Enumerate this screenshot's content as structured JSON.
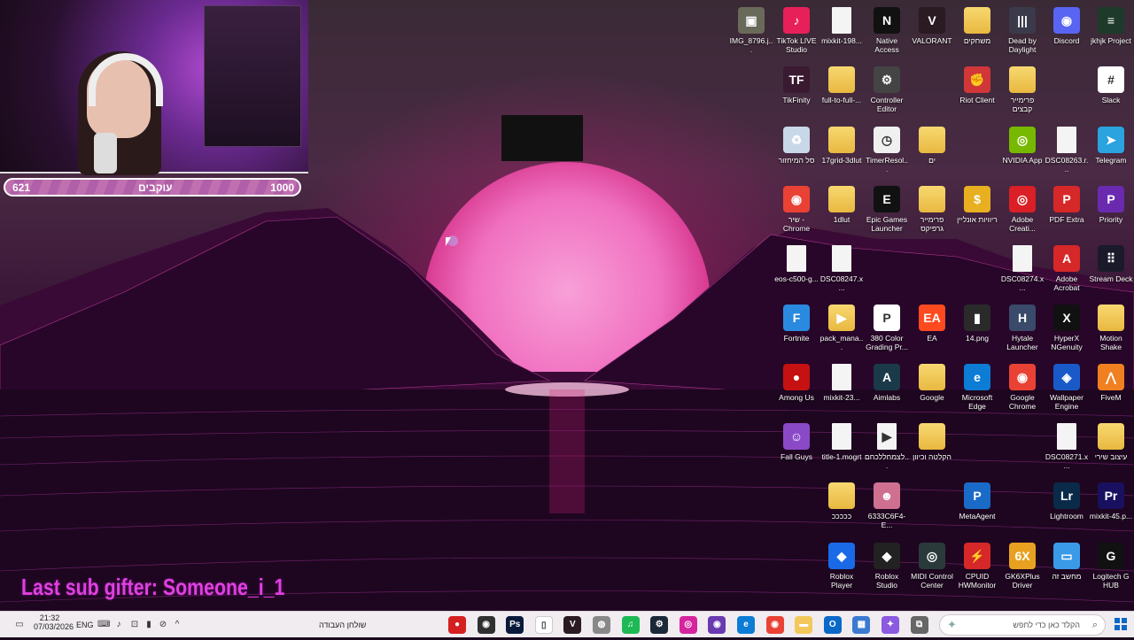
{
  "webcam": {
    "followers_current": "621",
    "followers_label": "עוקבים",
    "followers_goal": "1000",
    "progress": 0.62
  },
  "overlay": {
    "last_sub_gifter": "Last sub gifter: Someone_i_1"
  },
  "desktop_icons": [
    {
      "label": "IMG_8796.j...",
      "icon": "image-icon",
      "color": "#6a6a5a",
      "glyph": "▣"
    },
    {
      "label": "TikTok LIVE Studio",
      "icon": "tiktok-icon",
      "color": "#e8205a",
      "glyph": "♪"
    },
    {
      "label": "mixkit-198...",
      "icon": "file-icon",
      "color": "#f4f4f4",
      "glyph": ""
    },
    {
      "label": "Native Access",
      "icon": "native-access-icon",
      "color": "#111111",
      "glyph": "N"
    },
    {
      "label": "VALORANT",
      "icon": "valorant-icon",
      "color": "#2a1a22",
      "glyph": "V"
    },
    {
      "label": "משחקים",
      "icon": "folder-icon",
      "color": "#f2c85a",
      "glyph": ""
    },
    {
      "label": "Dead by Daylight",
      "icon": "dbd-icon",
      "color": "#3a3a4a",
      "glyph": "|||"
    },
    {
      "label": "Discord",
      "icon": "discord-icon",
      "color": "#5865f2",
      "glyph": "◉"
    },
    {
      "label": "jkhjk Project",
      "icon": "project-icon",
      "color": "#1e3a2a",
      "glyph": "≡"
    },
    {
      "label": "TikFinity",
      "icon": "tikfinity-icon",
      "color": "#3a1a30",
      "glyph": "TF"
    },
    {
      "label": "full-to-full-...",
      "icon": "folder-icon",
      "color": "#f2c85a",
      "glyph": ""
    },
    {
      "label": "Controller Editor",
      "icon": "controller-icon",
      "color": "#444444",
      "glyph": "⚙"
    },
    {
      "label": "Riot Client",
      "icon": "riot-icon",
      "color": "#d13639",
      "glyph": "✊"
    },
    {
      "label": "פרימייר קבצים",
      "icon": "folder-icon",
      "color": "#f2c85a",
      "glyph": ""
    },
    {
      "label": "Slack",
      "icon": "slack-icon",
      "color": "#ffffff",
      "glyph": "#"
    },
    {
      "label": "סל המיחזור",
      "icon": "recycle-bin-icon",
      "color": "#c8d8e8",
      "glyph": "♻"
    },
    {
      "label": "17grid-3dlut",
      "icon": "folder-icon",
      "color": "#f2c85a",
      "glyph": ""
    },
    {
      "label": "TimerResol...",
      "icon": "timer-icon",
      "color": "#f0f0f0",
      "glyph": "◷"
    },
    {
      "label": "ים",
      "icon": "folder-icon",
      "color": "#f2c85a",
      "glyph": ""
    },
    {
      "label": "NVIDIA App",
      "icon": "nvidia-icon",
      "color": "#76b900",
      "glyph": "◎"
    },
    {
      "label": "DSC08263.r...",
      "icon": "file-icon",
      "color": "#f4f4f4",
      "glyph": ""
    },
    {
      "label": "Telegram",
      "icon": "telegram-icon",
      "color": "#2aa3df",
      "glyph": "➤"
    },
    {
      "label": "שיר - Chrome",
      "icon": "chrome-icon",
      "color": "#e94235",
      "glyph": "◉"
    },
    {
      "label": "1dlut",
      "icon": "folder-icon",
      "color": "#f2c85a",
      "glyph": ""
    },
    {
      "label": "Epic Games Launcher",
      "icon": "epic-icon",
      "color": "#111111",
      "glyph": "E"
    },
    {
      "label": "פרימייר גרפיקס",
      "icon": "folder-icon",
      "color": "#f2c85a",
      "glyph": ""
    },
    {
      "label": "ריוויות אונליין",
      "icon": "coin-icon",
      "color": "#e8b020",
      "glyph": "$"
    },
    {
      "label": "Adobe Creati...",
      "icon": "adobe-cc-icon",
      "color": "#da1f26",
      "glyph": "◎"
    },
    {
      "label": "PDF Extra",
      "icon": "pdf-extra-icon",
      "color": "#d62828",
      "glyph": "P"
    },
    {
      "label": "Priority",
      "icon": "priority-icon",
      "color": "#6a2ab0",
      "glyph": "P"
    },
    {
      "label": "eos-c500-g...",
      "icon": "pdf-file-icon",
      "color": "#f4f4f4",
      "glyph": ""
    },
    {
      "label": "DSC08247.x...",
      "icon": "file-icon",
      "color": "#f4f4f4",
      "glyph": ""
    },
    {
      "label": "DSC08274.x...",
      "icon": "file-icon",
      "color": "#f4f4f4",
      "glyph": ""
    },
    {
      "label": "Adobe Acrobat",
      "icon": "acrobat-icon",
      "color": "#d62828",
      "glyph": "A"
    },
    {
      "label": "Stream Deck",
      "icon": "stream-deck-icon",
      "color": "#1a1a2a",
      "glyph": "⠿"
    },
    {
      "label": "Fortnite",
      "icon": "fortnite-icon",
      "color": "#2a8ae0",
      "glyph": "F"
    },
    {
      "label": "pack_mana...",
      "icon": "zip-folder-icon",
      "color": "#f2c85a",
      "glyph": "▶"
    },
    {
      "label": "380 Color Grading Pr...",
      "icon": "pset-icon",
      "color": "#ffffff",
      "glyph": "P"
    },
    {
      "label": "EA",
      "icon": "ea-icon",
      "color": "#ff4a20",
      "glyph": "EA"
    },
    {
      "label": "14.png",
      "icon": "png-file-icon",
      "color": "#2a2a2a",
      "glyph": "▮"
    },
    {
      "label": "Hytale Launcher",
      "icon": "hytale-icon",
      "color": "#3a4a6a",
      "glyph": "H"
    },
    {
      "label": "HyperX NGenuity",
      "icon": "hyperx-icon",
      "color": "#111111",
      "glyph": "X"
    },
    {
      "label": "Motion Shake",
      "icon": "folder-icon",
      "color": "#f2c85a",
      "glyph": ""
    },
    {
      "label": "Among Us",
      "icon": "among-us-icon",
      "color": "#c51111",
      "glyph": "●"
    },
    {
      "label": "mixkit-23...",
      "icon": "file-icon",
      "color": "#f4f4f4",
      "glyph": ""
    },
    {
      "label": "Aimlabs",
      "icon": "aimlabs-icon",
      "color": "#1a3a4a",
      "glyph": "A"
    },
    {
      "label": "Google",
      "icon": "folder-icon",
      "color": "#f2c85a",
      "glyph": ""
    },
    {
      "label": "Microsoft Edge",
      "icon": "edge-icon",
      "color": "#0c7cd5",
      "glyph": "e"
    },
    {
      "label": "Google Chrome",
      "icon": "chrome-icon",
      "color": "#e94235",
      "glyph": "◉"
    },
    {
      "label": "Wallpaper Engine",
      "icon": "wallpaper-engine-icon",
      "color": "#1a5ac8",
      "glyph": "◈"
    },
    {
      "label": "FiveM",
      "icon": "fivem-icon",
      "color": "#f08020",
      "glyph": "⋀"
    },
    {
      "label": "Fall Guys",
      "icon": "fall-guys-icon",
      "color": "#8a4ac8",
      "glyph": "☺"
    },
    {
      "label": "title-1.mogrt",
      "icon": "file-icon",
      "color": "#f4f4f4",
      "glyph": ""
    },
    {
      "label": "לצמחללכחם...",
      "icon": "video-file-icon",
      "color": "#f4f4f4",
      "glyph": "▶"
    },
    {
      "label": "הקלטה וכיוון",
      "icon": "folder-icon",
      "color": "#f2c85a",
      "glyph": ""
    },
    {
      "label": "DSC08271.x...",
      "icon": "file-icon",
      "color": "#f4f4f4",
      "glyph": ""
    },
    {
      "label": "עיצוב שירי",
      "icon": "folder-icon",
      "color": "#f2c85a",
      "glyph": ""
    },
    {
      "label": "כככככ",
      "icon": "folder-icon",
      "color": "#f2c85a",
      "glyph": ""
    },
    {
      "label": "6333C6F4-E...",
      "icon": "photo-icon",
      "color": "#d07090",
      "glyph": "☻"
    },
    {
      "label": "MetaAgent",
      "icon": "meta-agent-icon",
      "color": "#1a6ac8",
      "glyph": "P"
    },
    {
      "label": "Lightroom",
      "icon": "lightroom-icon",
      "color": "#0a2a4a",
      "glyph": "Lr"
    },
    {
      "label": "mixkit-45.p...",
      "icon": "premiere-project-icon",
      "color": "#1a1060",
      "glyph": "Pr"
    },
    {
      "label": "Roblox Player",
      "icon": "roblox-player-icon",
      "color": "#1a6ae8",
      "glyph": "◆"
    },
    {
      "label": "Roblox Studio",
      "icon": "roblox-studio-icon",
      "color": "#222222",
      "glyph": "◆"
    },
    {
      "label": "MIDI Control Center",
      "icon": "midi-icon",
      "color": "#2a3a3a",
      "glyph": "◎"
    },
    {
      "label": "CPUID HWMonitor",
      "icon": "hwmonitor-icon",
      "color": "#d62828",
      "glyph": "⚡"
    },
    {
      "label": "GK6XPlus Driver",
      "icon": "gk6x-icon",
      "color": "#e8a020",
      "glyph": "6X"
    },
    {
      "label": "מחשב זה",
      "icon": "this-pc-icon",
      "color": "#3a9ae8",
      "glyph": "▭"
    },
    {
      "label": "Logitech G HUB",
      "icon": "logitech-icon",
      "color": "#111111",
      "glyph": "G"
    }
  ],
  "taskbar": {
    "time": "21:32",
    "date": "07/03/2026",
    "language": "ENG",
    "desktop_label": "שולחן העבודה",
    "search_placeholder": "הקלד כאן כדי לחפש",
    "apps": [
      {
        "name": "taskbar-app-red",
        "color": "#d42020",
        "glyph": "●"
      },
      {
        "name": "taskbar-app-obs",
        "color": "#303030",
        "glyph": "◉"
      },
      {
        "name": "taskbar-app-photoshop",
        "color": "#0a1a3a",
        "glyph": "Ps"
      },
      {
        "name": "taskbar-app-file",
        "color": "#ffffff",
        "glyph": "▯"
      },
      {
        "name": "taskbar-app-valorant",
        "color": "#2a1a22",
        "glyph": "V"
      },
      {
        "name": "taskbar-app-steam-chat",
        "color": "#888888",
        "glyph": "◍"
      },
      {
        "name": "taskbar-app-spotify",
        "color": "#1db954",
        "glyph": "♫"
      },
      {
        "name": "taskbar-app-steam",
        "color": "#1b2838",
        "glyph": "⚙"
      },
      {
        "name": "taskbar-app-instagram",
        "color": "#d6249f",
        "glyph": "◎"
      },
      {
        "name": "taskbar-app-discord-like",
        "color": "#6a3ab0",
        "glyph": "◉"
      },
      {
        "name": "taskbar-app-edge",
        "color": "#0c7cd5",
        "glyph": "e"
      },
      {
        "name": "taskbar-app-chrome",
        "color": "#e94235",
        "glyph": "◉"
      },
      {
        "name": "taskbar-app-explorer",
        "color": "#f2c85a",
        "glyph": "▬"
      },
      {
        "name": "taskbar-app-outlook",
        "color": "#0a68c8",
        "glyph": "O"
      },
      {
        "name": "taskbar-app-store",
        "color": "#3a7ad0",
        "glyph": "▦"
      },
      {
        "name": "taskbar-app-copilot",
        "color": "#8a5ae0",
        "glyph": "✦"
      },
      {
        "name": "taskbar-app-taskview",
        "color": "#666666",
        "glyph": "⧉"
      }
    ]
  }
}
